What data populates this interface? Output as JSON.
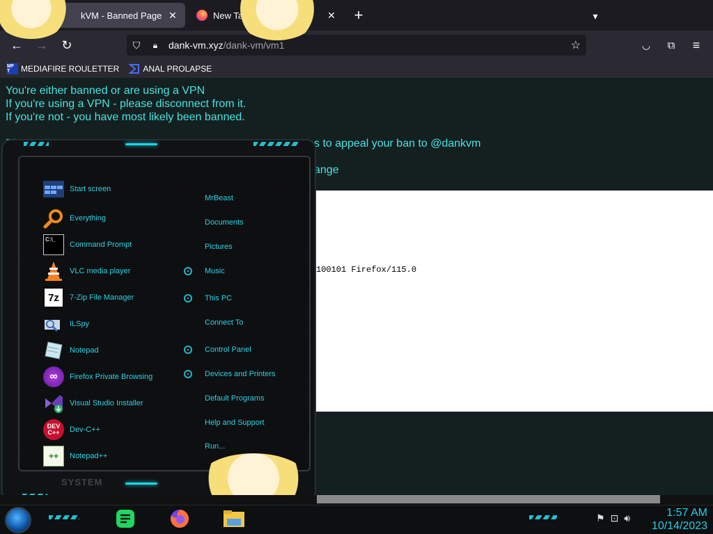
{
  "browser": {
    "tabs": [
      {
        "title": "kVM - Banned Page",
        "active": true
      },
      {
        "title": "New Tab",
        "active": false
      }
    ],
    "url_host": "dank-vm.xyz",
    "url_path": "/dank-vm/vm1",
    "bookmarks": [
      {
        "label": "MEDIAFIRE ROULETTER",
        "icon_text": "MF T"
      },
      {
        "label": "ANAL PROLAPSE",
        "icon_text": ""
      }
    ]
  },
  "page": {
    "lines": [
      "You're either banned or are using a VPN",
      "If you're using a VPN - please disconnect from it.",
      "If you're not - you have most likely been banned."
    ],
    "appeal_fragment_start": "Pl",
    "appeal_fragment_end": "s to appeal your ban to @dankvm",
    "fragment2": "ange",
    "user_agent_fragment": "100101 Firefox/115.0"
  },
  "start_menu": {
    "programs": [
      {
        "label": "Start screen",
        "icon": "start-screen-icon"
      },
      {
        "label": "Everything",
        "icon": "magnifier-icon"
      },
      {
        "label": "Command Prompt",
        "icon": "cmd-icon",
        "icon_text": "C:\\_"
      },
      {
        "label": "VLC media player",
        "icon": "vlc-cone-icon"
      },
      {
        "label": "7-Zip File Manager",
        "icon": "sevenzip-icon",
        "icon_text": "7z"
      },
      {
        "label": "ILSpy",
        "icon": "ilspy-icon"
      },
      {
        "label": "Notepad",
        "icon": "notepad-icon"
      },
      {
        "label": "Firefox Private Browsing",
        "icon": "firefox-private-icon"
      },
      {
        "label": "Visual Studio Installer",
        "icon": "vs-installer-icon"
      },
      {
        "label": "Dev-C++",
        "icon": "devcpp-icon",
        "icon_text": "DEV C++"
      },
      {
        "label": "Notepad++",
        "icon": "notepadpp-icon",
        "icon_text": "++"
      }
    ],
    "places": [
      {
        "label": "MrBeast",
        "bullet": false
      },
      {
        "label": "Documents",
        "bullet": false
      },
      {
        "label": "Pictures",
        "bullet": false
      },
      {
        "label": "Music",
        "bullet": true
      },
      {
        "label": "This PC",
        "bullet": true
      },
      {
        "label": "Connect To",
        "bullet": false
      },
      {
        "label": "Control Panel",
        "bullet": true
      },
      {
        "label": "Devices and Printers",
        "bullet": true
      },
      {
        "label": "Default Programs",
        "bullet": false
      },
      {
        "label": "Help and Support",
        "bullet": false
      },
      {
        "label": "Run...",
        "bullet": false
      }
    ],
    "system_label": "SYSTEM"
  },
  "taskbar": {
    "apps": [
      "notes-app-icon",
      "firefox-icon",
      "file-explorer-icon"
    ],
    "time": "1:57 AM",
    "date": "10/14/2023"
  },
  "colors": {
    "accent_cyan": "#28d3e8",
    "page_text": "#46e3e3",
    "page_bg": "#141f1f"
  }
}
